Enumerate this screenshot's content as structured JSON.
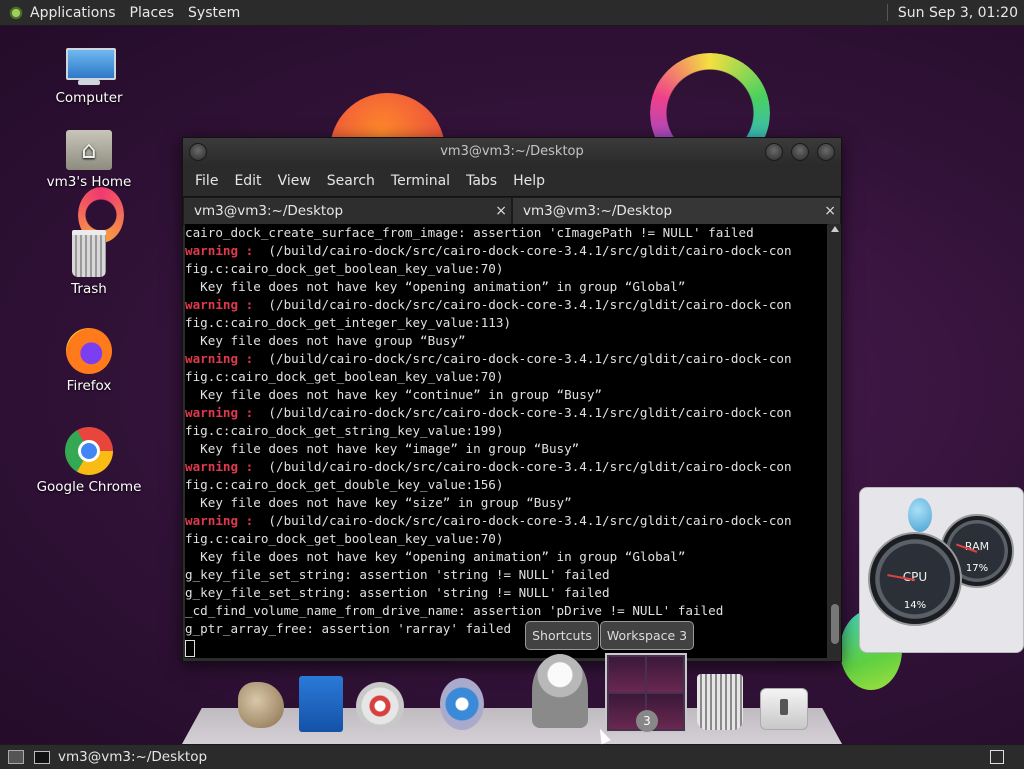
{
  "top_panel": {
    "menus": [
      "Applications",
      "Places",
      "System"
    ],
    "clock": "Sun Sep  3, 01:20"
  },
  "desktop_icons": [
    {
      "label": "Computer",
      "icon": "computer-icon"
    },
    {
      "label": "vm3's Home",
      "icon": "home-folder-icon"
    },
    {
      "label": "Trash",
      "icon": "trash-icon"
    },
    {
      "label": "Firefox",
      "icon": "firefox-icon"
    },
    {
      "label": "Google Chrome",
      "icon": "chrome-icon"
    }
  ],
  "terminal": {
    "title": "vm3@vm3:~/Desktop",
    "menu": [
      "File",
      "Edit",
      "View",
      "Search",
      "Terminal",
      "Tabs",
      "Help"
    ],
    "tabs": [
      {
        "label": "vm3@vm3:~/Desktop",
        "close": "×"
      },
      {
        "label": "vm3@vm3:~/Desktop",
        "close": "×"
      }
    ],
    "lines": [
      {
        "w": "",
        "t": "cairo_dock_create_surface_from_image: assertion 'cImagePath != NULL' failed"
      },
      {
        "w": "warning : ",
        "t": " (/build/cairo-dock/src/cairo-dock-core-3.4.1/src/gldit/cairo-dock-con"
      },
      {
        "w": "",
        "t": "fig.c:cairo_dock_get_boolean_key_value:70)"
      },
      {
        "w": "",
        "t": "  Key file does not have key “opening animation” in group “Global”"
      },
      {
        "w": "warning : ",
        "t": " (/build/cairo-dock/src/cairo-dock-core-3.4.1/src/gldit/cairo-dock-con"
      },
      {
        "w": "",
        "t": "fig.c:cairo_dock_get_integer_key_value:113)"
      },
      {
        "w": "",
        "t": "  Key file does not have group “Busy”"
      },
      {
        "w": "warning : ",
        "t": " (/build/cairo-dock/src/cairo-dock-core-3.4.1/src/gldit/cairo-dock-con"
      },
      {
        "w": "",
        "t": "fig.c:cairo_dock_get_boolean_key_value:70)"
      },
      {
        "w": "",
        "t": "  Key file does not have key “continue” in group “Busy”"
      },
      {
        "w": "warning : ",
        "t": " (/build/cairo-dock/src/cairo-dock-core-3.4.1/src/gldit/cairo-dock-con"
      },
      {
        "w": "",
        "t": "fig.c:cairo_dock_get_string_key_value:199)"
      },
      {
        "w": "",
        "t": "  Key file does not have key “image” in group “Busy”"
      },
      {
        "w": "warning : ",
        "t": " (/build/cairo-dock/src/cairo-dock-core-3.4.1/src/gldit/cairo-dock-con"
      },
      {
        "w": "",
        "t": "fig.c:cairo_dock_get_double_key_value:156)"
      },
      {
        "w": "",
        "t": "  Key file does not have key “size” in group “Busy”"
      },
      {
        "w": "warning : ",
        "t": " (/build/cairo-dock/src/cairo-dock-core-3.4.1/src/gldit/cairo-dock-con"
      },
      {
        "w": "",
        "t": "fig.c:cairo_dock_get_boolean_key_value:70)"
      },
      {
        "w": "",
        "t": "  Key file does not have key “opening animation” in group “Global”"
      },
      {
        "w": "",
        "t": "g_key_file_set_string: assertion 'string != NULL' failed"
      },
      {
        "w": "",
        "t": "g_key_file_set_string: assertion 'string != NULL' failed"
      },
      {
        "w": "",
        "t": "_cd_find_volume_name_from_drive_name: assertion 'pDrive != NULL' failed"
      },
      {
        "w": "",
        "t": "g_ptr_array_free: assertion 'rarray' failed"
      }
    ]
  },
  "dock": {
    "labels": {
      "shortcuts": "Shortcuts",
      "workspace": "Workspace 3"
    },
    "workspace_badge": "3",
    "items": [
      "gimp-icon",
      "writer-icon",
      "dvd-icon",
      "compass-icon",
      "mail-icon",
      "workspaces-icon",
      "trash-icon",
      "switch-icon"
    ]
  },
  "gauges": {
    "cpu": {
      "label": "CPU",
      "value": "14%"
    },
    "ram": {
      "label": "RAM",
      "value": "17%"
    }
  },
  "bottom_panel": {
    "task": "vm3@vm3:~/Desktop"
  },
  "colors": {
    "warning": "#e0384c",
    "panel": "#2b2b2b",
    "terminal_bg": "#000000"
  }
}
